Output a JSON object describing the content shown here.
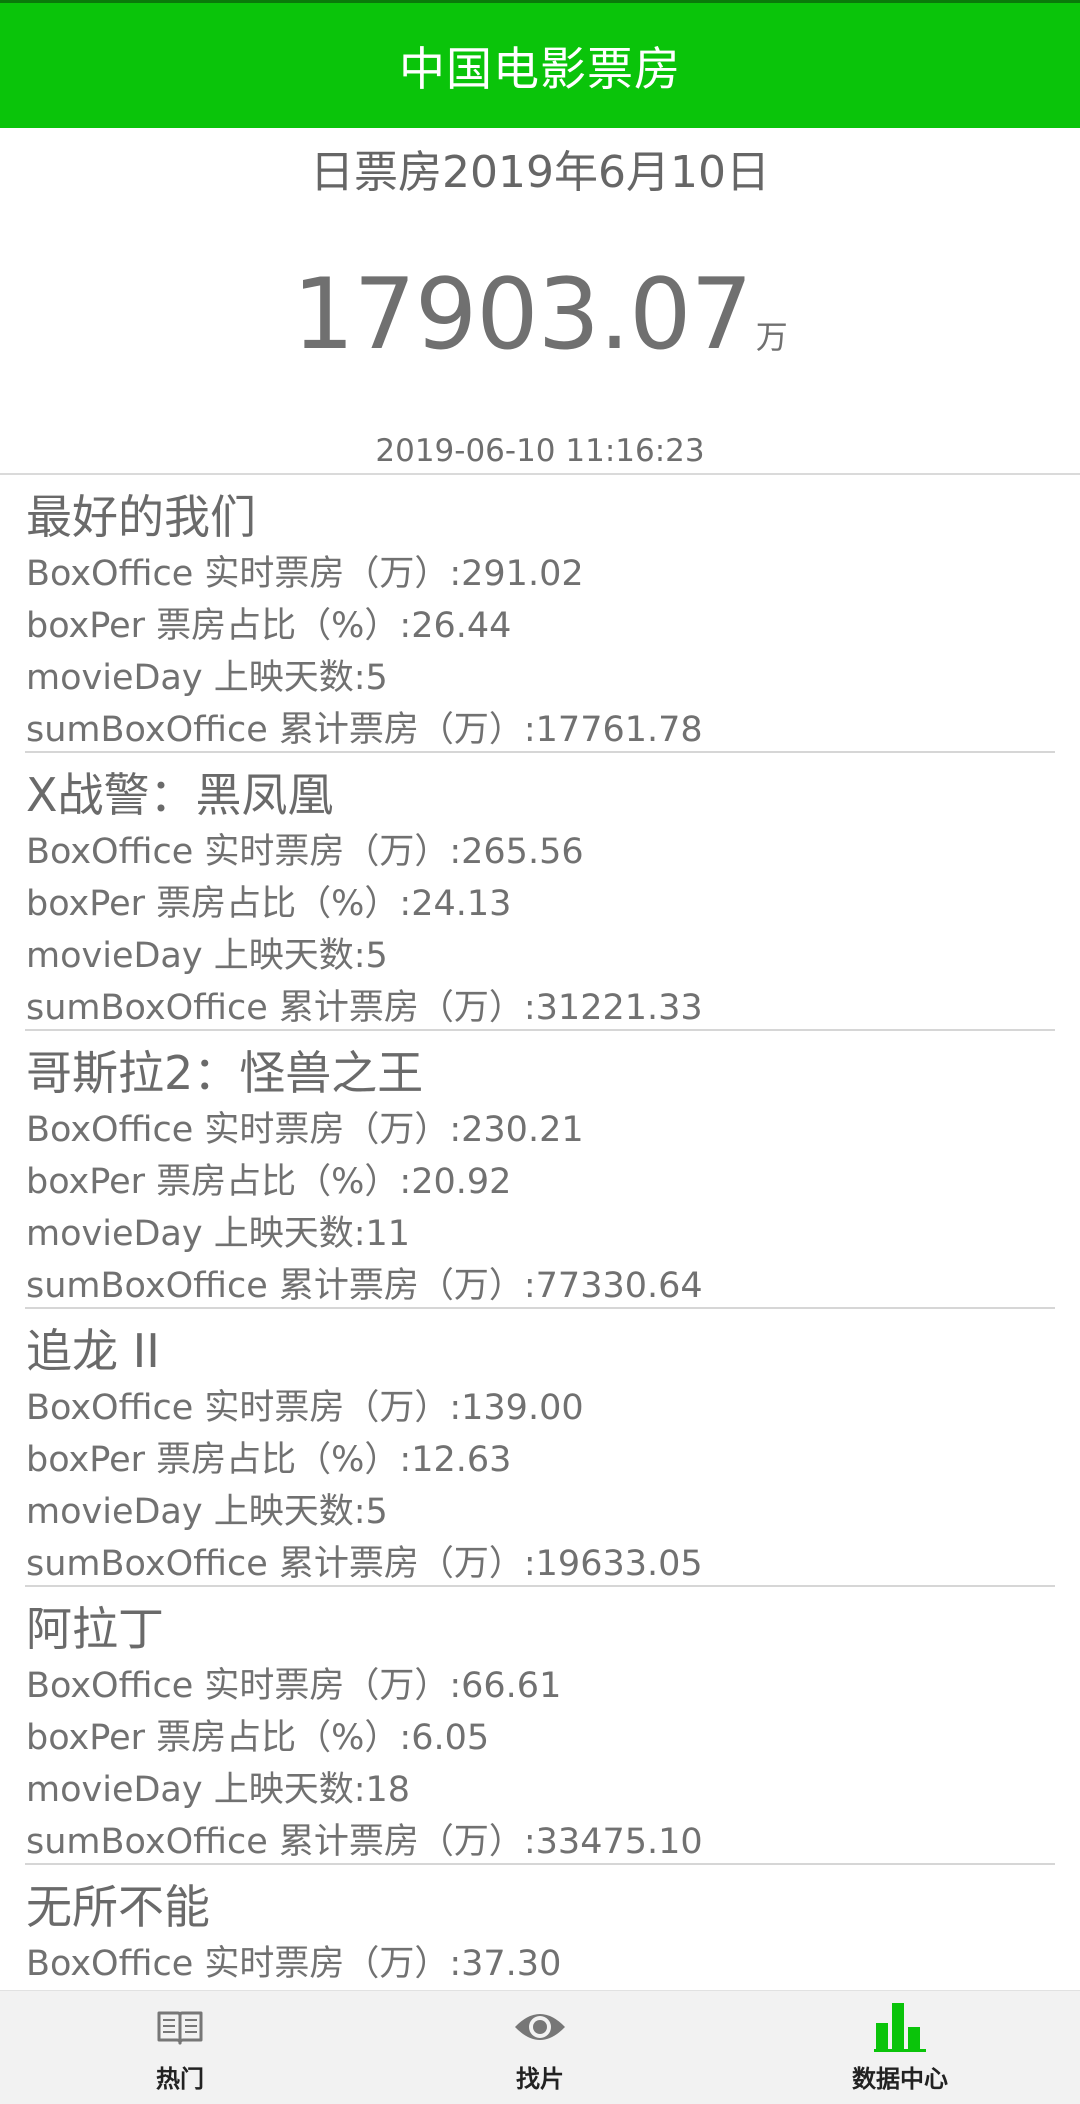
{
  "header": {
    "title": "中国电影票房"
  },
  "summary": {
    "date_title": "日票房2019年6月10日",
    "total": "17903.07",
    "unit": "万",
    "timestamp": "2019-06-10 11:16:23"
  },
  "movies": [
    {
      "title": "最好的我们",
      "box_office": "BoxOffice 实时票房（万）:291.02",
      "box_per": "boxPer 票房占比（%）:26.44",
      "movie_day": "movieDay 上映天数:5",
      "sum_box_office": "sumBoxOffice 累计票房（万）:17761.78"
    },
    {
      "title": "X战警：黑凤凰",
      "box_office": "BoxOffice 实时票房（万）:265.56",
      "box_per": "boxPer 票房占比（%）:24.13",
      "movie_day": "movieDay 上映天数:5",
      "sum_box_office": "sumBoxOffice 累计票房（万）:31221.33"
    },
    {
      "title": "哥斯拉2：怪兽之王",
      "box_office": "BoxOffice 实时票房（万）:230.21",
      "box_per": "boxPer 票房占比（%）:20.92",
      "movie_day": "movieDay 上映天数:11",
      "sum_box_office": "sumBoxOffice 累计票房（万）:77330.64"
    },
    {
      "title": "追龙 II",
      "box_office": "BoxOffice 实时票房（万）:139.00",
      "box_per": "boxPer 票房占比（%）:12.63",
      "movie_day": "movieDay 上映天数:5",
      "sum_box_office": "sumBoxOffice 累计票房（万）:19633.05"
    },
    {
      "title": "阿拉丁",
      "box_office": "BoxOffice 实时票房（万）:66.61",
      "box_per": "boxPer 票房占比（%）:6.05",
      "movie_day": "movieDay 上映天数:18",
      "sum_box_office": "sumBoxOffice 累计票房（万）:33475.10"
    },
    {
      "title": "无所不能",
      "box_office": "BoxOffice 实时票房（万）:37.30"
    }
  ],
  "tabbar": {
    "tabs": [
      {
        "label": "热门",
        "icon": "book-icon"
      },
      {
        "label": "找片",
        "icon": "eye-icon"
      },
      {
        "label": "数据中心",
        "icon": "bar-chart-icon"
      }
    ],
    "active_index": 2,
    "colors": {
      "header": "#0ac40a",
      "active_icon": "#0ac40a",
      "inactive_icon": "#777777"
    }
  }
}
